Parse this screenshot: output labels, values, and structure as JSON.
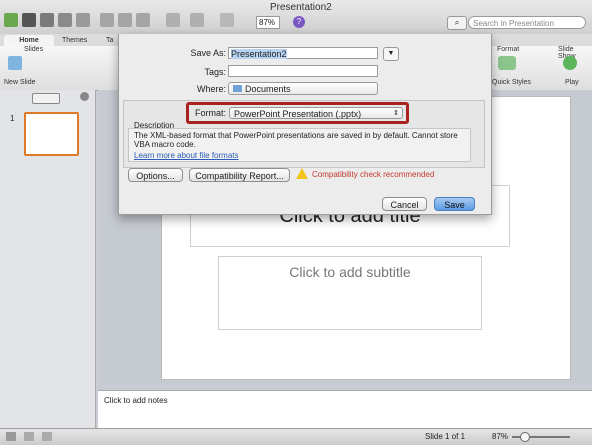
{
  "window": {
    "title": "Presentation2"
  },
  "toolbar": {
    "zoom": "87%",
    "search_placeholder": "Search in Presentation",
    "help": "?"
  },
  "ribbon": {
    "tabs": [
      "Home",
      "Themes",
      "Ta"
    ],
    "groups": {
      "slides": "Slides",
      "new_slide": "New Slide",
      "format": "Format",
      "quick_styles": "Quick Styles",
      "slide_show": "Slide Show",
      "play": "Play"
    }
  },
  "left_pane": {
    "slide_number": "1"
  },
  "slide": {
    "title_placeholder": "Click to add title",
    "subtitle_placeholder": "Click to add subtitle"
  },
  "notes": {
    "placeholder": "Click to add notes"
  },
  "status": {
    "slide_info": "Slide 1 of 1",
    "zoom": "87%"
  },
  "dialog": {
    "save_as_label": "Save As:",
    "save_as_value": "Presentation2",
    "tags_label": "Tags:",
    "tags_value": "",
    "where_label": "Where:",
    "where_value": "Documents",
    "format_label": "Format:",
    "format_value": "PowerPoint Presentation (.pptx)",
    "description_heading": "Description",
    "description_text": "The XML-based format that PowerPoint presentations are saved in by default. Cannot store VBA macro code.",
    "learn_more": "Learn more about file formats",
    "options_button": "Options...",
    "compat_button": "Compatibility Report...",
    "compat_warning": "Compatibility check recommended",
    "cancel_button": "Cancel",
    "save_button": "Save"
  },
  "colors": {
    "highlight": "#a8221f",
    "accent": "#5b9be3",
    "thumb_border": "#e07a26",
    "warning": "#c0392b"
  }
}
